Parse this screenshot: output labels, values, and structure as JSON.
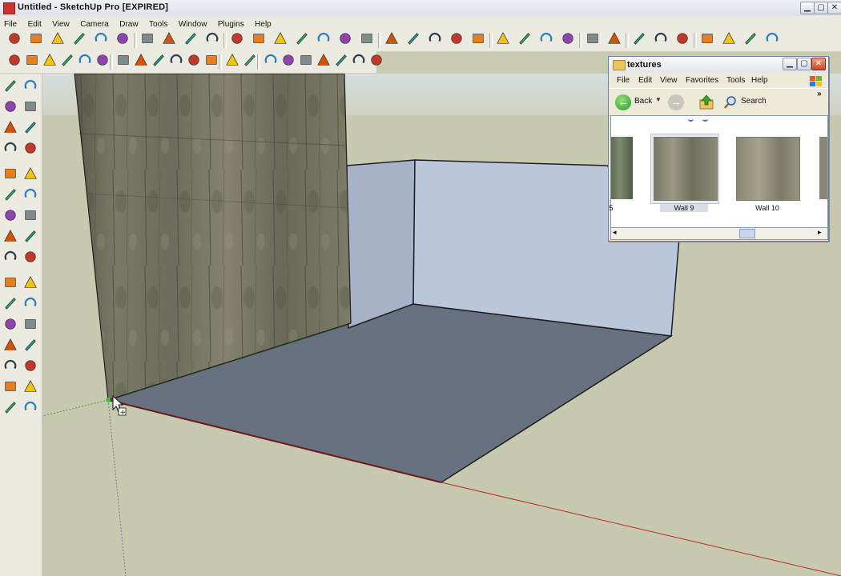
{
  "window": {
    "title": "Untitled - SketchUp Pro [EXPIRED]"
  },
  "menubar": {
    "items": [
      "File",
      "Edit",
      "View",
      "Camera",
      "Draw",
      "Tools",
      "Window",
      "Plugins",
      "Help"
    ]
  },
  "explorer": {
    "title": "textures",
    "menu": [
      "File",
      "Edit",
      "View",
      "Favorites",
      "Tools",
      "Help"
    ],
    "back_label": "Back",
    "search_label": "Search",
    "chevron": "»",
    "thumbnails": [
      {
        "label": "5"
      },
      {
        "label": "Wall 9",
        "selected": true
      },
      {
        "label": "Wall 10"
      }
    ]
  },
  "icons": {
    "toolbar_top": [
      "select-icon",
      "pencil-icon",
      "rectangle-icon",
      "circle-icon",
      "arc-icon",
      "make-component-icon",
      "eraser-icon",
      "tape-measure-icon",
      "paint-bucket-icon",
      "push-pull-icon",
      "move-icon",
      "rotate-icon",
      "follow-me-icon",
      "scale-icon",
      "pan-icon",
      "zoom-icon",
      "zoom-extents-icon",
      "get-models-icon",
      "share-model-icon",
      "google-earth-icon",
      "previous-view-icon",
      "next-view-icon",
      "orbit-icon",
      "line-icon",
      "offset-icon",
      "paint-icon",
      "refresh-icon",
      "sandbox-icon",
      "smoove-icon",
      "drape-icon",
      "flip-edge-icon",
      "play-icon",
      "rewind-icon",
      "ui-icon",
      "ruby-icon"
    ],
    "toolbar_views": [
      "iso-view-icon",
      "top-view-icon",
      "front-view-icon",
      "right-view-icon",
      "back-view-icon",
      "left-view-icon",
      "xray-icon",
      "wireframe-icon",
      "hidden-line-icon",
      "shaded-icon",
      "textured-icon",
      "monochrome-icon",
      "section-plane-icon",
      "display-section-icon",
      "fog-icon",
      "shadow-icon",
      "solid-union-icon",
      "solid-subtract-icon",
      "solid-trim-icon",
      "solid-split-icon",
      "outer-shell-icon"
    ],
    "left_tools": [
      "select-icon",
      "make-component-icon",
      "paint-bucket-icon",
      "eraser-icon",
      "rectangle-icon",
      "line-icon",
      "circle-icon",
      "arc-icon",
      "polygon-icon",
      "freehand-icon",
      "move-icon",
      "push-pull-icon",
      "rotate-icon",
      "follow-me-icon",
      "scale-icon",
      "offset-icon",
      "tape-measure-icon",
      "dimension-icon",
      "protractor-icon",
      "text-icon",
      "axes-icon",
      "3d-text-icon",
      "orbit-icon",
      "pan-icon",
      "zoom-icon",
      "zoom-window-icon",
      "zoom-extents-icon",
      "previous-icon",
      "position-camera-icon",
      "look-around-icon",
      "walk-icon",
      "section-plane-icon"
    ]
  }
}
